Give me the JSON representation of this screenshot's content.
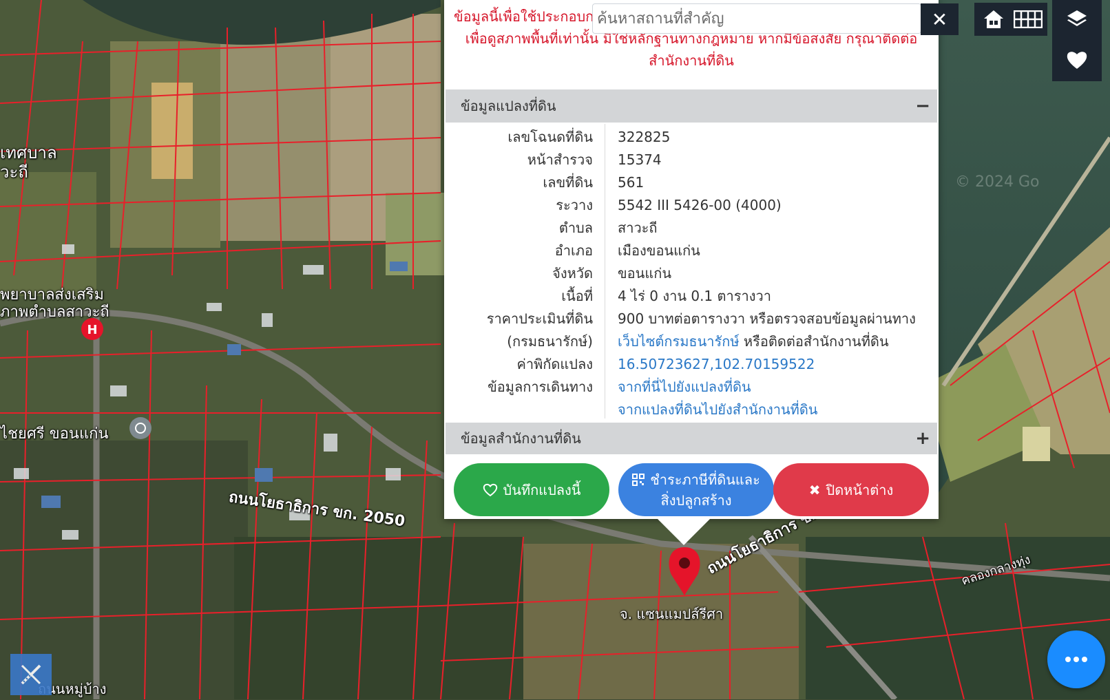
{
  "notice": {
    "line1": "ข้อมูลนี้เพื่อใช้ประกอบการ",
    "line2": "เพื่อดูสภาพพื้นที่เท่านั้น มิใช่หลักฐานทางกฎหมาย หากมีข้อสงสัย กรุณาติดต่อ",
    "line3": "สำนักงานที่ดิน"
  },
  "search": {
    "placeholder": "ค้นหาสถานที่สำคัญ",
    "clear_icon": "close-icon"
  },
  "controls": [
    {
      "name": "home-icon"
    },
    {
      "name": "grid-icon"
    },
    {
      "name": "layers-icon"
    },
    {
      "name": "heart-icon"
    }
  ],
  "parcel_section": {
    "title": "ข้อมูลแปลงที่ดิน",
    "toggle": "−",
    "rows": [
      {
        "label": "เลขโฉนดที่ดิน",
        "value": "322825"
      },
      {
        "label": "หน้าสำรวจ",
        "value": "15374"
      },
      {
        "label": "เลขที่ดิน",
        "value": "561"
      },
      {
        "label": "ระวาง",
        "value": "5542 III 5426-00 (4000)"
      },
      {
        "label": "ตำบล",
        "value": "สาวะถี"
      },
      {
        "label": "อำเภอ",
        "value": "เมืองขอนแก่น"
      },
      {
        "label": "จังหวัด",
        "value": "ขอนแก่น"
      },
      {
        "label": "เนื้อที่",
        "value": "4 ไร่ 0 งาน 0.1 ตารางวา"
      }
    ],
    "price": {
      "label1": "ราคาประเมินที่ดิน",
      "label2": "(กรมธนารักษ์)",
      "value1": "900 บาทต่อตารางวา หรือตรวจสอบข้อมูลผ่านทาง",
      "link": "เว็บไซต์กรมธนารักษ์",
      "value2": " หรือติดต่อสำนักงานที่ดิน"
    },
    "coords": {
      "label": "ค่าพิกัดแปลง",
      "value": "16.50723627,102.70159522"
    },
    "travel": {
      "label": "ข้อมูลการเดินทาง",
      "link1": "จากที่นี่ไปยังแปลงที่ดิน",
      "link2": "จากแปลงที่ดินไปยังสำนักงานที่ดิน"
    }
  },
  "office_section": {
    "title": "ข้อมูลสำนักงานที่ดิน",
    "toggle": "+"
  },
  "buttons": {
    "save": {
      "label": "บันทึกแปลงนี้",
      "color": "#2ba84a"
    },
    "tax": {
      "label1": "ชำระภาษีที่ดินและ",
      "label2": "สิ่งปลูกสร้าง",
      "color": "#3b82e0"
    },
    "close": {
      "label": "ปิดหน้าต่าง",
      "color": "#e03a4a"
    }
  },
  "map_labels": {
    "label_1": "เทศบาล",
    "label_2": "วะถี",
    "label_3": "พยาบาลส่งเสริม",
    "label_4": "ภาพตำบลสาวะถี",
    "label_5": "ไชยศรี ขอนแก่น",
    "label_6": "ถนนโยธาธิการ ขก. 2050",
    "label_7": "ถนนโยธาธิการ ขก.",
    "label_8": "คลองกลางทุ่ง",
    "label_9": "ถนนหมู่บ้าง",
    "label_10": "© 2024 Go",
    "pin_caption": "จ. แซนแมปส์รีศา"
  },
  "colors": {
    "accent_red": "#d6162a",
    "link_blue": "#2a78c7",
    "parcel_line": "#e8202a"
  }
}
